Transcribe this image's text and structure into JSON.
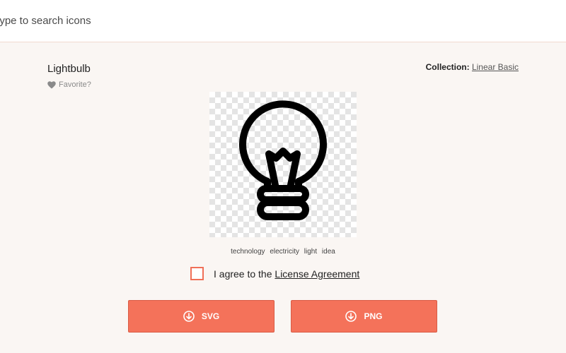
{
  "search": {
    "placeholder": "Type to search icons"
  },
  "icon": {
    "title": "Lightbulb",
    "favorite_label": "Favorite?",
    "collection_label": "Collection:",
    "collection_name": "Linear Basic",
    "tags": [
      "technology",
      "electricity",
      "light",
      "idea"
    ]
  },
  "license": {
    "prefix": "I agree to the",
    "link": "License Agreement"
  },
  "downloads": {
    "svg_label": "SVG",
    "png_label": "PNG"
  },
  "colors": {
    "accent": "#f4725a",
    "page_background": "#faf6f3"
  }
}
